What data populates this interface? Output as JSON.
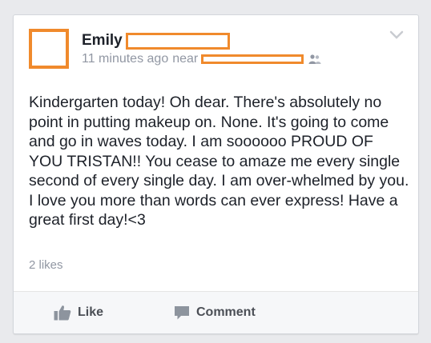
{
  "post": {
    "author_name": "Emily",
    "time": "11 minutes ago",
    "near_label": "near",
    "text": "Kindergarten today! Oh dear. There's absolutely no point in putting makeup on. None. It's going to come and go in waves today. I am soooooo PROUD OF YOU TRISTAN!! You cease to amaze me every single second of every single day. I am over-whelmed by you. I love you more than words can ever express! Have a great first day!<3",
    "likes_count": "2 likes"
  },
  "actions": {
    "like_label": "Like",
    "comment_label": "Comment"
  },
  "icons": {
    "audience": "friends-icon",
    "menu": "chevron-down-icon",
    "like": "thumbs-up-icon",
    "comment": "speech-bubble-icon"
  },
  "colors": {
    "redaction_outline": "#f08a2c",
    "meta_text": "#9197a3",
    "body_text": "#1d2129"
  }
}
